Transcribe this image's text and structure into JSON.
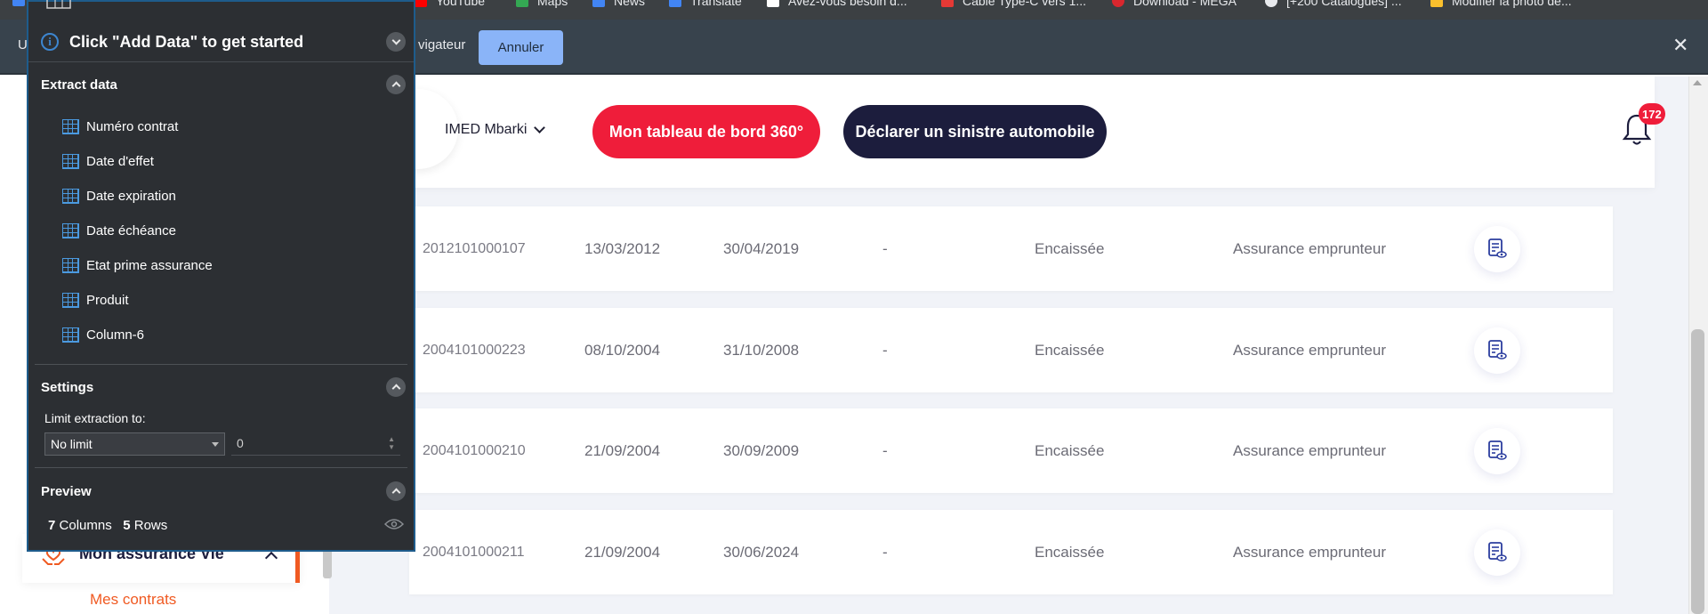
{
  "bookmarks": [
    {
      "label": "YouTube",
      "icon": "youtube-icon",
      "color": "#ff0000"
    },
    {
      "label": "Maps",
      "icon": "maps-icon",
      "color": "#34a853"
    },
    {
      "label": "News",
      "icon": "news-icon",
      "color": "#4285f4"
    },
    {
      "label": "Translate",
      "icon": "translate-icon",
      "color": "#4285f4"
    },
    {
      "label": "Avez-vous besoin d...",
      "icon": "flag-icon",
      "color": "#ffffff"
    },
    {
      "label": "Câble Type-C vers 1...",
      "icon": "shop-icon",
      "color": "#e53935"
    },
    {
      "label": "Download - MEGA",
      "icon": "mega-icon",
      "color": "#d9272e"
    },
    {
      "label": "[+200 Catalogues] ...",
      "icon": "globe-icon",
      "color": "#e8eaed"
    },
    {
      "label": "Modifier la photo de...",
      "icon": "bookmark-icon",
      "color": "#fbc02d"
    }
  ],
  "infobar": {
    "lead": "U",
    "message": "vigateur",
    "cancel_label": "Annuler",
    "close_glyph": "✕"
  },
  "header": {
    "user_name": "IMED Mbarki",
    "dashboard_button": "Mon tableau de bord 360°",
    "claim_button": "Déclarer un sinistre automobile",
    "notification_count": "172",
    "colors": {
      "red": "#ef1d3a",
      "navy": "#1c1d3d"
    }
  },
  "contracts": [
    {
      "number": "2012101000107",
      "date1": "13/03/2012",
      "date2": "30/04/2019",
      "date3": "-",
      "status": "Encaissée",
      "product": "Assurance emprunteur"
    },
    {
      "number": "2004101000223",
      "date1": "08/10/2004",
      "date2": "31/10/2008",
      "date3": "-",
      "status": "Encaissée",
      "product": "Assurance emprunteur"
    },
    {
      "number": "2004101000210",
      "date1": "21/09/2004",
      "date2": "30/09/2009",
      "date3": "-",
      "status": "Encaissée",
      "product": "Assurance emprunteur"
    },
    {
      "number": "2004101000211",
      "date1": "21/09/2004",
      "date2": "30/06/2024",
      "date3": "-",
      "status": "Encaissée",
      "product": "Assurance emprunteur"
    }
  ],
  "sidebar": {
    "menu_label": "Mon assurance Vie",
    "submenu_label": "Mes contrats",
    "accent": "#f05a22"
  },
  "panel": {
    "hint": "Click \"Add Data\" to get started",
    "extract_title": "Extract data",
    "fields": [
      "Numéro contrat",
      "Date d'effet",
      "Date expiration",
      "Date échéance",
      "Etat prime assurance",
      "Produit",
      "Column-6"
    ],
    "settings_title": "Settings",
    "limit_label": "Limit extraction to:",
    "limit_select": "No limit",
    "limit_value": "0",
    "preview_title": "Preview",
    "preview_columns": "7",
    "preview_columns_label": "Columns",
    "preview_rows": "5",
    "preview_rows_label": "Rows"
  }
}
